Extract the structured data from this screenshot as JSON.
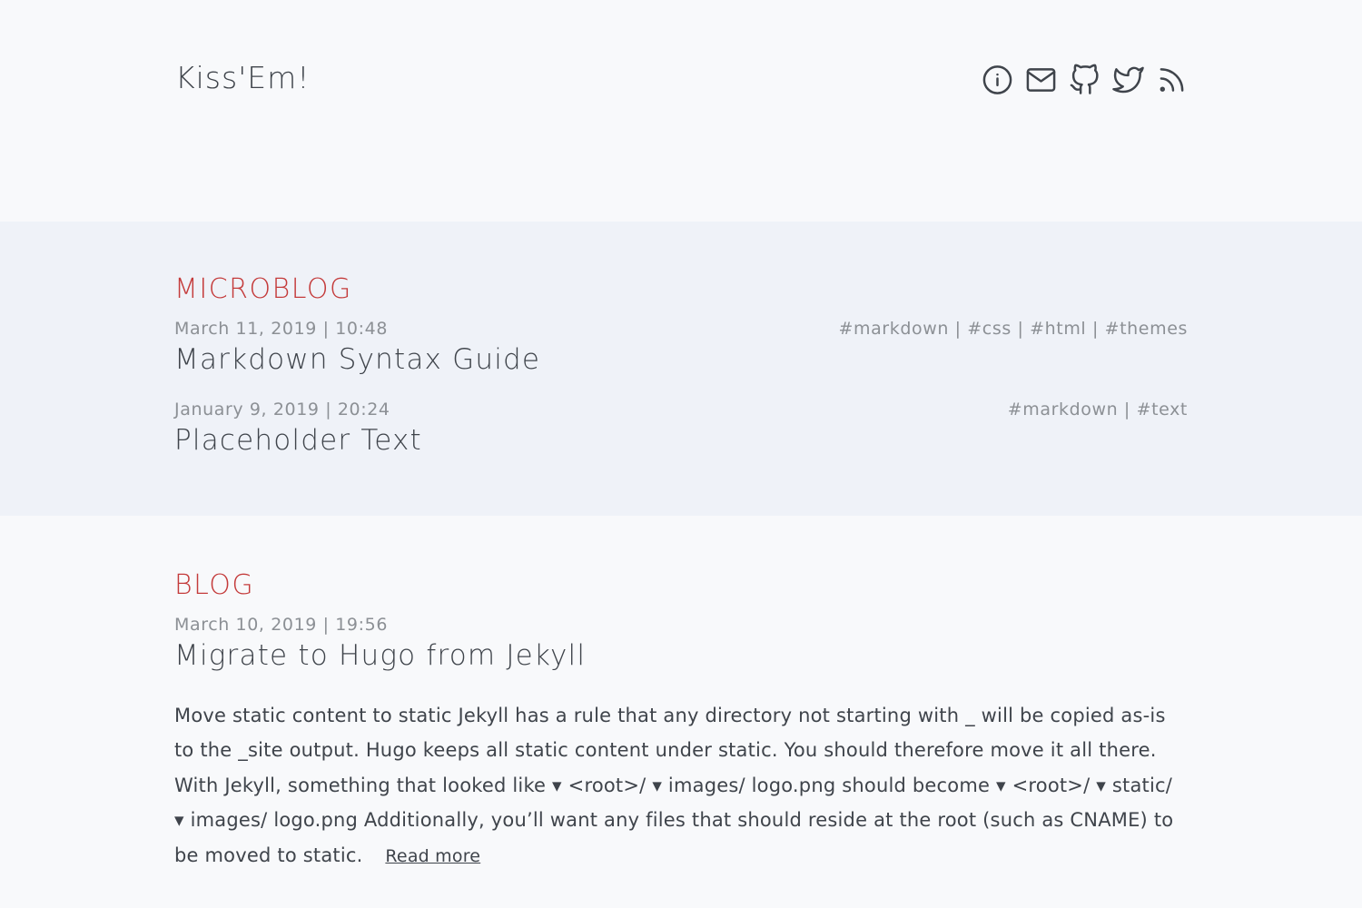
{
  "header": {
    "site_title": "Kiss'Em!",
    "icons": [
      "info-icon",
      "mail-icon",
      "github-icon",
      "twitter-icon",
      "rss-icon"
    ]
  },
  "microblog": {
    "title": "MICROBLOG",
    "posts": [
      {
        "meta": "March 11, 2019 | 10:48",
        "title": "Markdown Syntax Guide",
        "tags": "#markdown | #css | #html | #themes"
      },
      {
        "meta": "January 9, 2019 | 20:24",
        "title": "Placeholder Text",
        "tags": "#markdown | #text"
      }
    ]
  },
  "blog": {
    "title": "BLOG",
    "posts": [
      {
        "meta": "March 10, 2019 | 19:56",
        "title": "Migrate to Hugo from Jekyll",
        "summary": "Move static content to static Jekyll has a rule that any directory not starting with _ will be copied as-is to the _site output. Hugo keeps all static content under static. You should therefore move it all there. With Jekyll, something that looked like ▾ <root>/ ▾ images/ logo.png should become ▾ <root>/ ▾ static/ ▾ images/ logo.png Additionally, you’ll want any files that should reside at the root (such as CNAME) to be moved to static.",
        "read_more": "Read more"
      }
    ]
  },
  "colors": {
    "accent": "#c43b3b",
    "text": "#3f444b",
    "muted": "#8c9095",
    "band": "#eff2f8",
    "background": "#f8f9fb"
  }
}
